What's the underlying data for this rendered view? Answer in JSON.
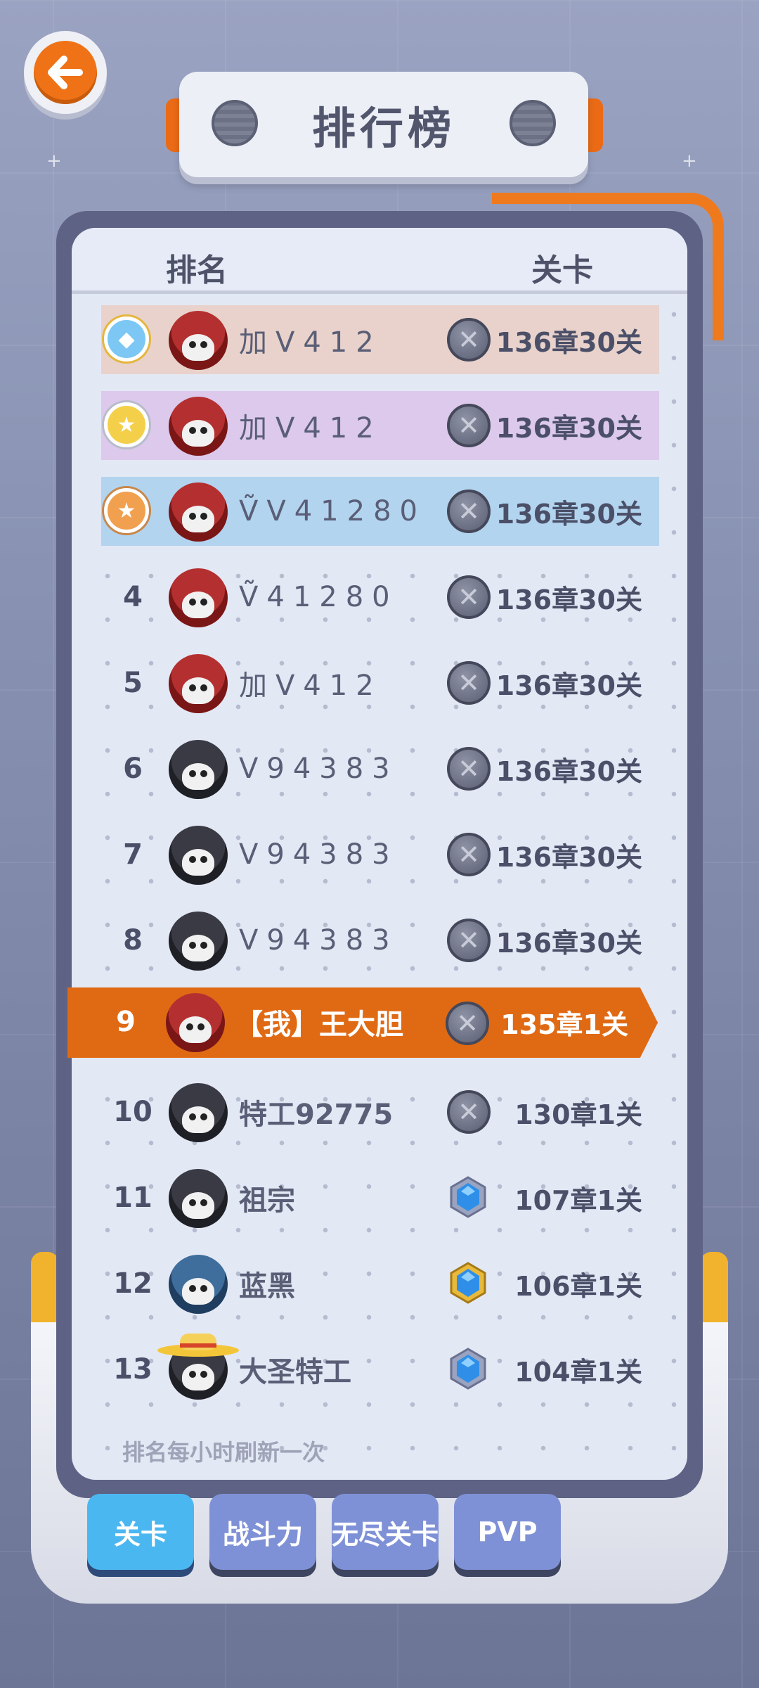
{
  "title": "排行榜",
  "header": {
    "rank_label": "排名",
    "level_label": "关卡"
  },
  "rows": [
    {
      "rank": "",
      "medal": "gold",
      "avatar": "red",
      "name": "加V412",
      "badge": "x",
      "level": "136章30关"
    },
    {
      "rank": "",
      "medal": "silver",
      "avatar": "red",
      "name": "加V412",
      "badge": "x",
      "level": "136章30关"
    },
    {
      "rank": "",
      "medal": "bronze",
      "avatar": "red",
      "name": "ṼV41280",
      "badge": "x",
      "level": "136章30关"
    },
    {
      "rank": "4",
      "avatar": "red",
      "name": "Ṽ41280",
      "badge": "x",
      "level": "136章30关"
    },
    {
      "rank": "5",
      "avatar": "red",
      "name": "加V412",
      "badge": "x",
      "level": "136章30关"
    },
    {
      "rank": "6",
      "avatar": "dark",
      "name": "V94383",
      "badge": "x",
      "level": "136章30关"
    },
    {
      "rank": "7",
      "avatar": "dark",
      "name": "V94383",
      "badge": "x",
      "level": "136章30关"
    },
    {
      "rank": "8",
      "avatar": "dark",
      "name": "V94383",
      "badge": "x",
      "level": "136章30关"
    },
    {
      "rank": "10",
      "avatar": "dark",
      "name": "特工92775",
      "badge": "x",
      "level": "130章1关"
    },
    {
      "rank": "11",
      "avatar": "dark",
      "name": "祖宗",
      "badge": "gem-blue",
      "level": "107章1关"
    },
    {
      "rank": "12",
      "avatar": "blue",
      "name": "蓝黑",
      "badge": "gem-gold",
      "level": "106章1关"
    },
    {
      "rank": "13",
      "avatar": "dark-hat",
      "name": "大圣特工",
      "badge": "gem-blue",
      "level": "104章1关"
    }
  ],
  "self": {
    "rank": "9",
    "name": "【我】王大胆",
    "level": "135章1关"
  },
  "footer_note": "排名每小时刷新一次",
  "tabs": [
    "关卡",
    "战斗力",
    "无尽关卡",
    "PVP"
  ],
  "colors": {
    "accent_orange": "#e06a14",
    "active_tab": "#4bb7f0"
  }
}
